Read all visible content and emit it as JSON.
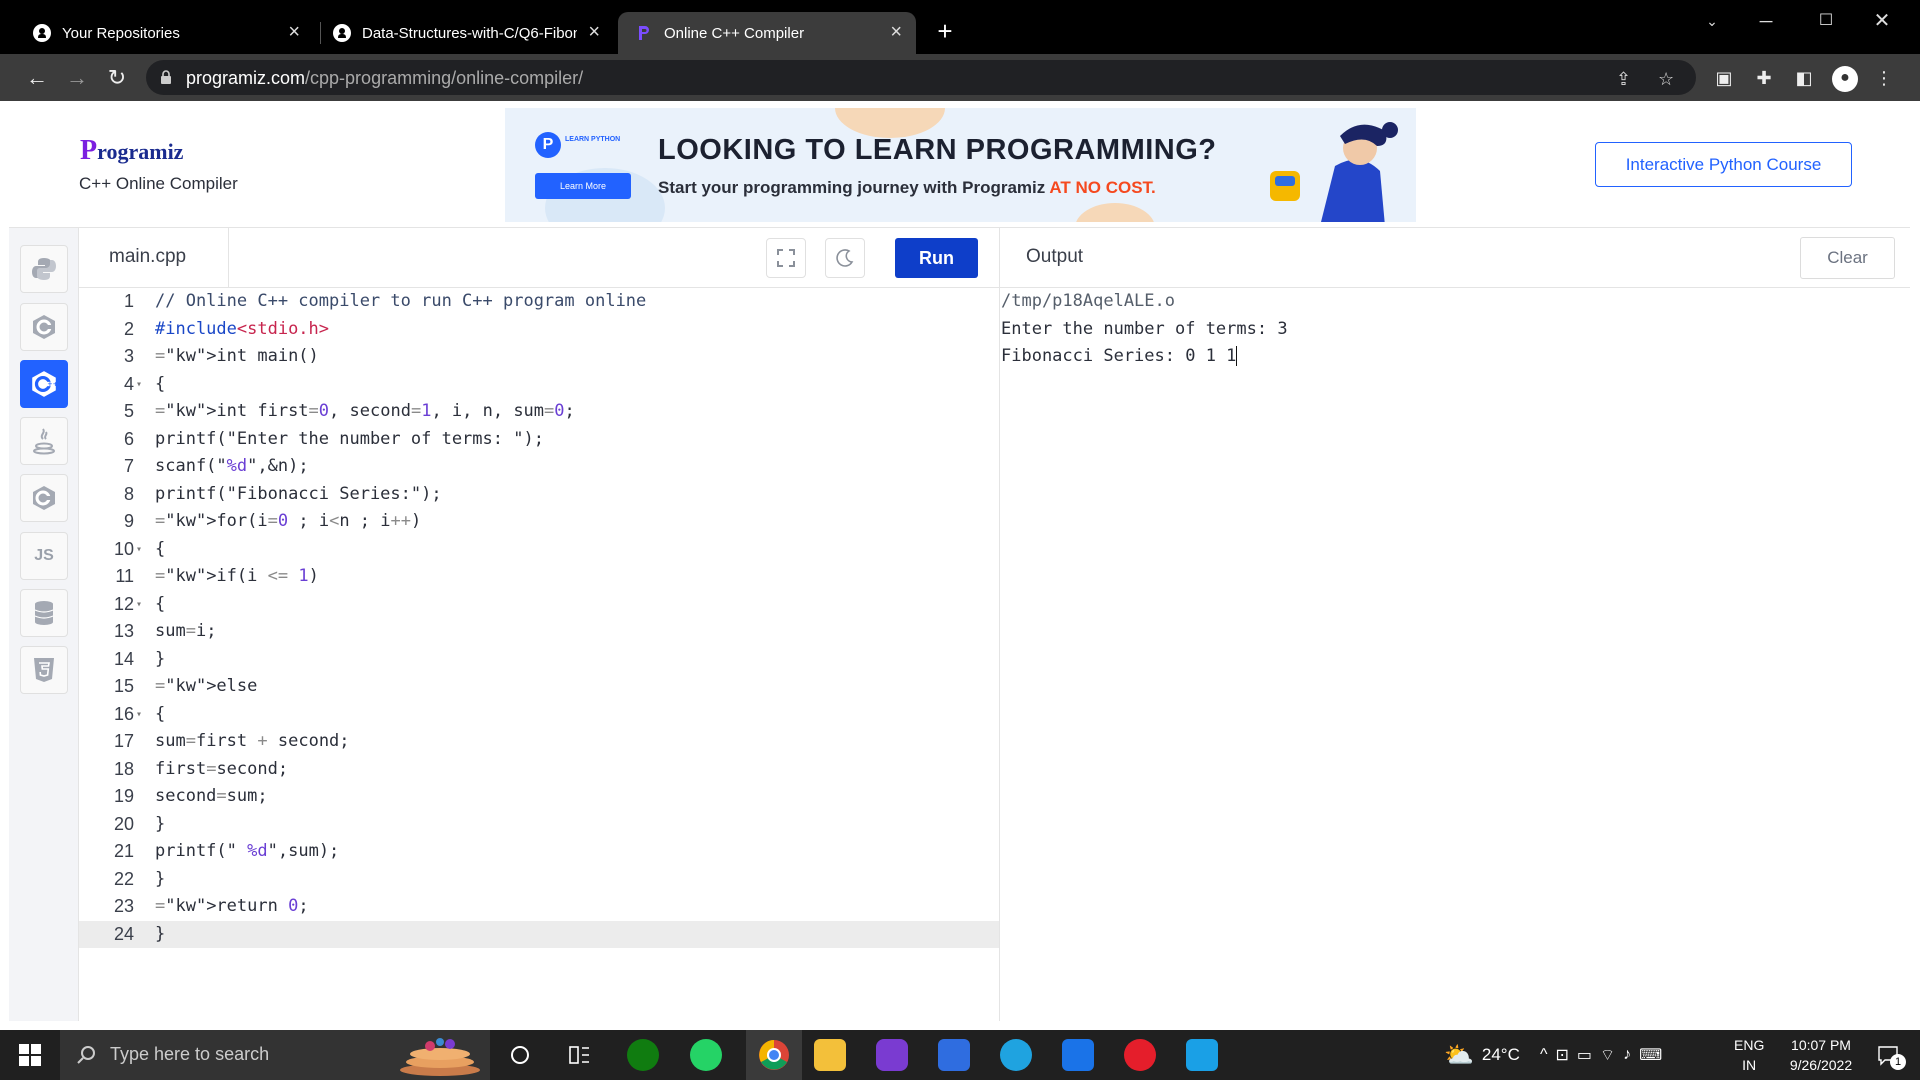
{
  "browser": {
    "tabs": [
      {
        "title": "Your Repositories",
        "active": false
      },
      {
        "title": "Data-Structures-with-C/Q6-Fibon",
        "active": false
      },
      {
        "title": "Online C++ Compiler",
        "active": true
      }
    ],
    "url_host": "programiz.com",
    "url_path": "/cpp-programming/online-compiler/"
  },
  "header": {
    "logo": "rogramiz",
    "logo_p": "P",
    "subtitle": "C++ Online Compiler",
    "banner": {
      "tag": "LEARN PYTHON",
      "learn_more": "Learn More",
      "headline": "LOOKING TO LEARN PROGRAMMING?",
      "tagline": "Start your programming journey with Programiz ",
      "tagline_highlight": "AT NO COST."
    },
    "course_button": "Interactive Python Course"
  },
  "rail": {
    "items": [
      "python-icon",
      "c-icon",
      "cpp-icon",
      "java-icon",
      "csharp-icon",
      "js-icon",
      "sql-icon",
      "html-icon"
    ],
    "js_label": "JS"
  },
  "editor": {
    "filename": "main.cpp",
    "run_label": "Run",
    "lines": [
      "// Online C++ compiler to run C++ program online",
      "#include<stdio.h>",
      "int main()",
      "{",
      "int first=0, second=1, i, n, sum=0;",
      "printf(\"Enter the number of terms: \");",
      "scanf(\"%d\",&n);",
      "printf(\"Fibonacci Series:\");",
      "for(i=0 ; i<n ; i++)",
      "{",
      "if(i <= 1)",
      "{",
      "sum=i;",
      "}",
      "else",
      "{",
      "sum=first + second;",
      "first=second;",
      "second=sum;",
      "}",
      "printf(\" %d\",sum);",
      "}",
      "return 0;",
      "}"
    ]
  },
  "output": {
    "title": "Output",
    "clear_label": "Clear",
    "lines": [
      "/tmp/p18AqelALE.o",
      "Enter the number of terms: 3",
      "Fibonacci Series: 0 1 1"
    ]
  },
  "taskbar": {
    "search_placeholder": "Type here to search",
    "weather": "24°C",
    "language": "ENG",
    "region": "IN",
    "time": "10:07 PM",
    "date": "9/26/2022",
    "notifications": "1"
  }
}
